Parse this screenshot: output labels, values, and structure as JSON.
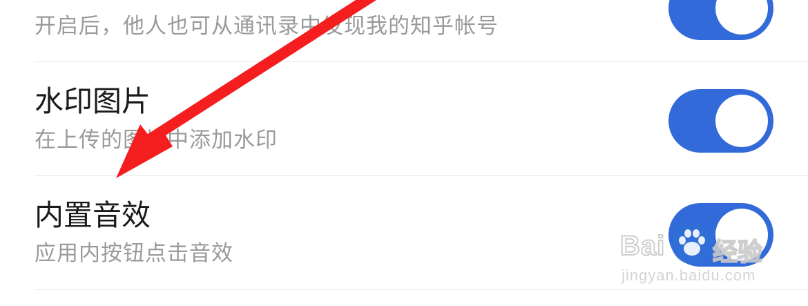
{
  "settings": {
    "items": [
      {
        "title": "",
        "subtitle": "开启后，他人也可从通讯录中发现我的知乎帐号",
        "enabled": true
      },
      {
        "title": "水印图片",
        "subtitle": "在上传的图片中添加水印",
        "enabled": true
      },
      {
        "title": "内置音效",
        "subtitle": "应用内按钮点击音效",
        "enabled": true
      }
    ]
  },
  "annotation": {
    "arrow_color": "#f51e1e",
    "icon": "arrow-icon"
  },
  "watermark": {
    "brand": "Bai",
    "brand_suffix": "经验",
    "url": "jingyan.baidu.com",
    "icon": "baidu-paw-icon"
  },
  "colors": {
    "toggle_on": "#326ad9",
    "title_text": "#1a1a1a",
    "subtitle_text": "#9a9a9a",
    "divider": "#e6e6e6"
  }
}
